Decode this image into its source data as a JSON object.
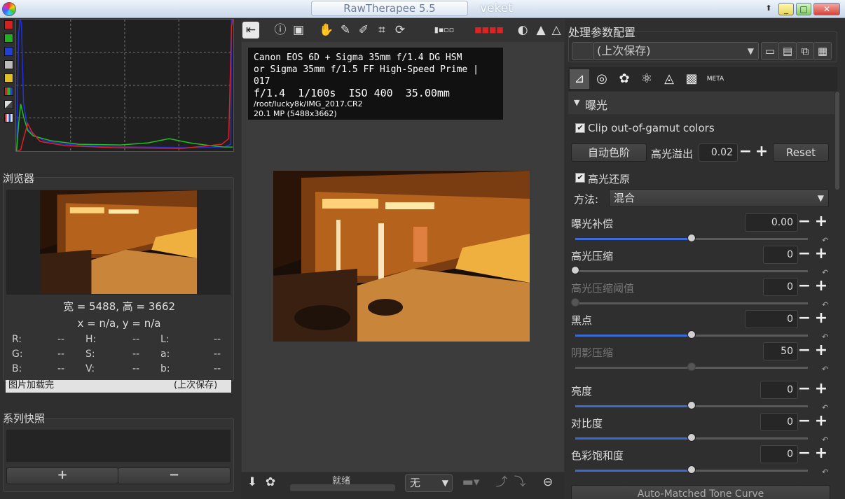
{
  "window": {
    "title": "RawTherapee 5.5",
    "desktop_label": "veket",
    "up_glyph": "⬆",
    "min_glyph": "_",
    "max_glyph": "□",
    "close_glyph": "✕"
  },
  "colors": {
    "accent": "#3b6bd6",
    "histogram_red": "#e02020",
    "histogram_green": "#20c020",
    "histogram_blue": "#2020e0"
  },
  "navigator": {
    "title": "浏览器",
    "size_text": "宽 = 5488, 高 = 3662",
    "coord_text": "x = n/a, y = n/a",
    "readouts": [
      {
        "label": "R:",
        "value": "--"
      },
      {
        "label": "H:",
        "value": "--"
      },
      {
        "label": "L:",
        "value": "--"
      },
      {
        "label": "G:",
        "value": "--"
      },
      {
        "label": "S:",
        "value": "--"
      },
      {
        "label": "a:",
        "value": "--"
      },
      {
        "label": "B:",
        "value": "--"
      },
      {
        "label": "V:",
        "value": "--"
      },
      {
        "label": "b:",
        "value": "--"
      }
    ]
  },
  "filmstrip": {
    "left_text": "图片加载完",
    "right_text": "(上次保存)"
  },
  "snapshots": {
    "title": "系列快照",
    "add_label": "+",
    "remove_label": "−"
  },
  "exif": {
    "line1": "Canon EOS 6D + Sigma 35mm f/1.4 DG HSM",
    "line2": " or Sigma 35mm f/1.5 FF High-Speed Prime | 017",
    "aperture": "f/1.4",
    "shutter": "1/100s",
    "iso": "ISO 400",
    "focal": "35.00mm",
    "path": "/root/lucky8k/IMG_2017.CR2",
    "megapixels": "20.1 MP (5488x3662)"
  },
  "status": {
    "text": "就绪",
    "zoom_value": "无"
  },
  "profile": {
    "title": "处理参数配置",
    "selected": "(上次保存)"
  },
  "exposure": {
    "section_title": "曝光",
    "clip_label": "Clip out-of-gamut colors",
    "auto_levels_label": "自动色阶",
    "clip_threshold_label": "高光溢出",
    "clip_threshold_value": "0.02",
    "reset_label": "Reset",
    "highlight_recon_label": "高光还原",
    "method_label": "方法:",
    "method_value": "混合",
    "sliders": [
      {
        "label": "曝光补偿",
        "value": "0.00",
        "fraction": 0.5,
        "enabled": true
      },
      {
        "label": "高光压缩",
        "value": "0",
        "fraction": 0.0,
        "enabled": true
      },
      {
        "label": "高光压缩阈值",
        "value": "0",
        "fraction": 0.0,
        "enabled": false
      },
      {
        "label": "黑点",
        "value": "0",
        "fraction": 0.5,
        "enabled": true
      },
      {
        "label": "阴影压缩",
        "value": "50",
        "fraction": 0.5,
        "enabled": false
      },
      {
        "label": "亮度",
        "value": "0",
        "fraction": 0.5,
        "enabled": true
      },
      {
        "label": "对比度",
        "value": "0",
        "fraction": 0.5,
        "enabled": true
      },
      {
        "label": "色彩饱和度",
        "value": "0",
        "fraction": 0.5,
        "enabled": true
      }
    ],
    "tone_curve_label": "Auto-Matched Tone Curve"
  }
}
